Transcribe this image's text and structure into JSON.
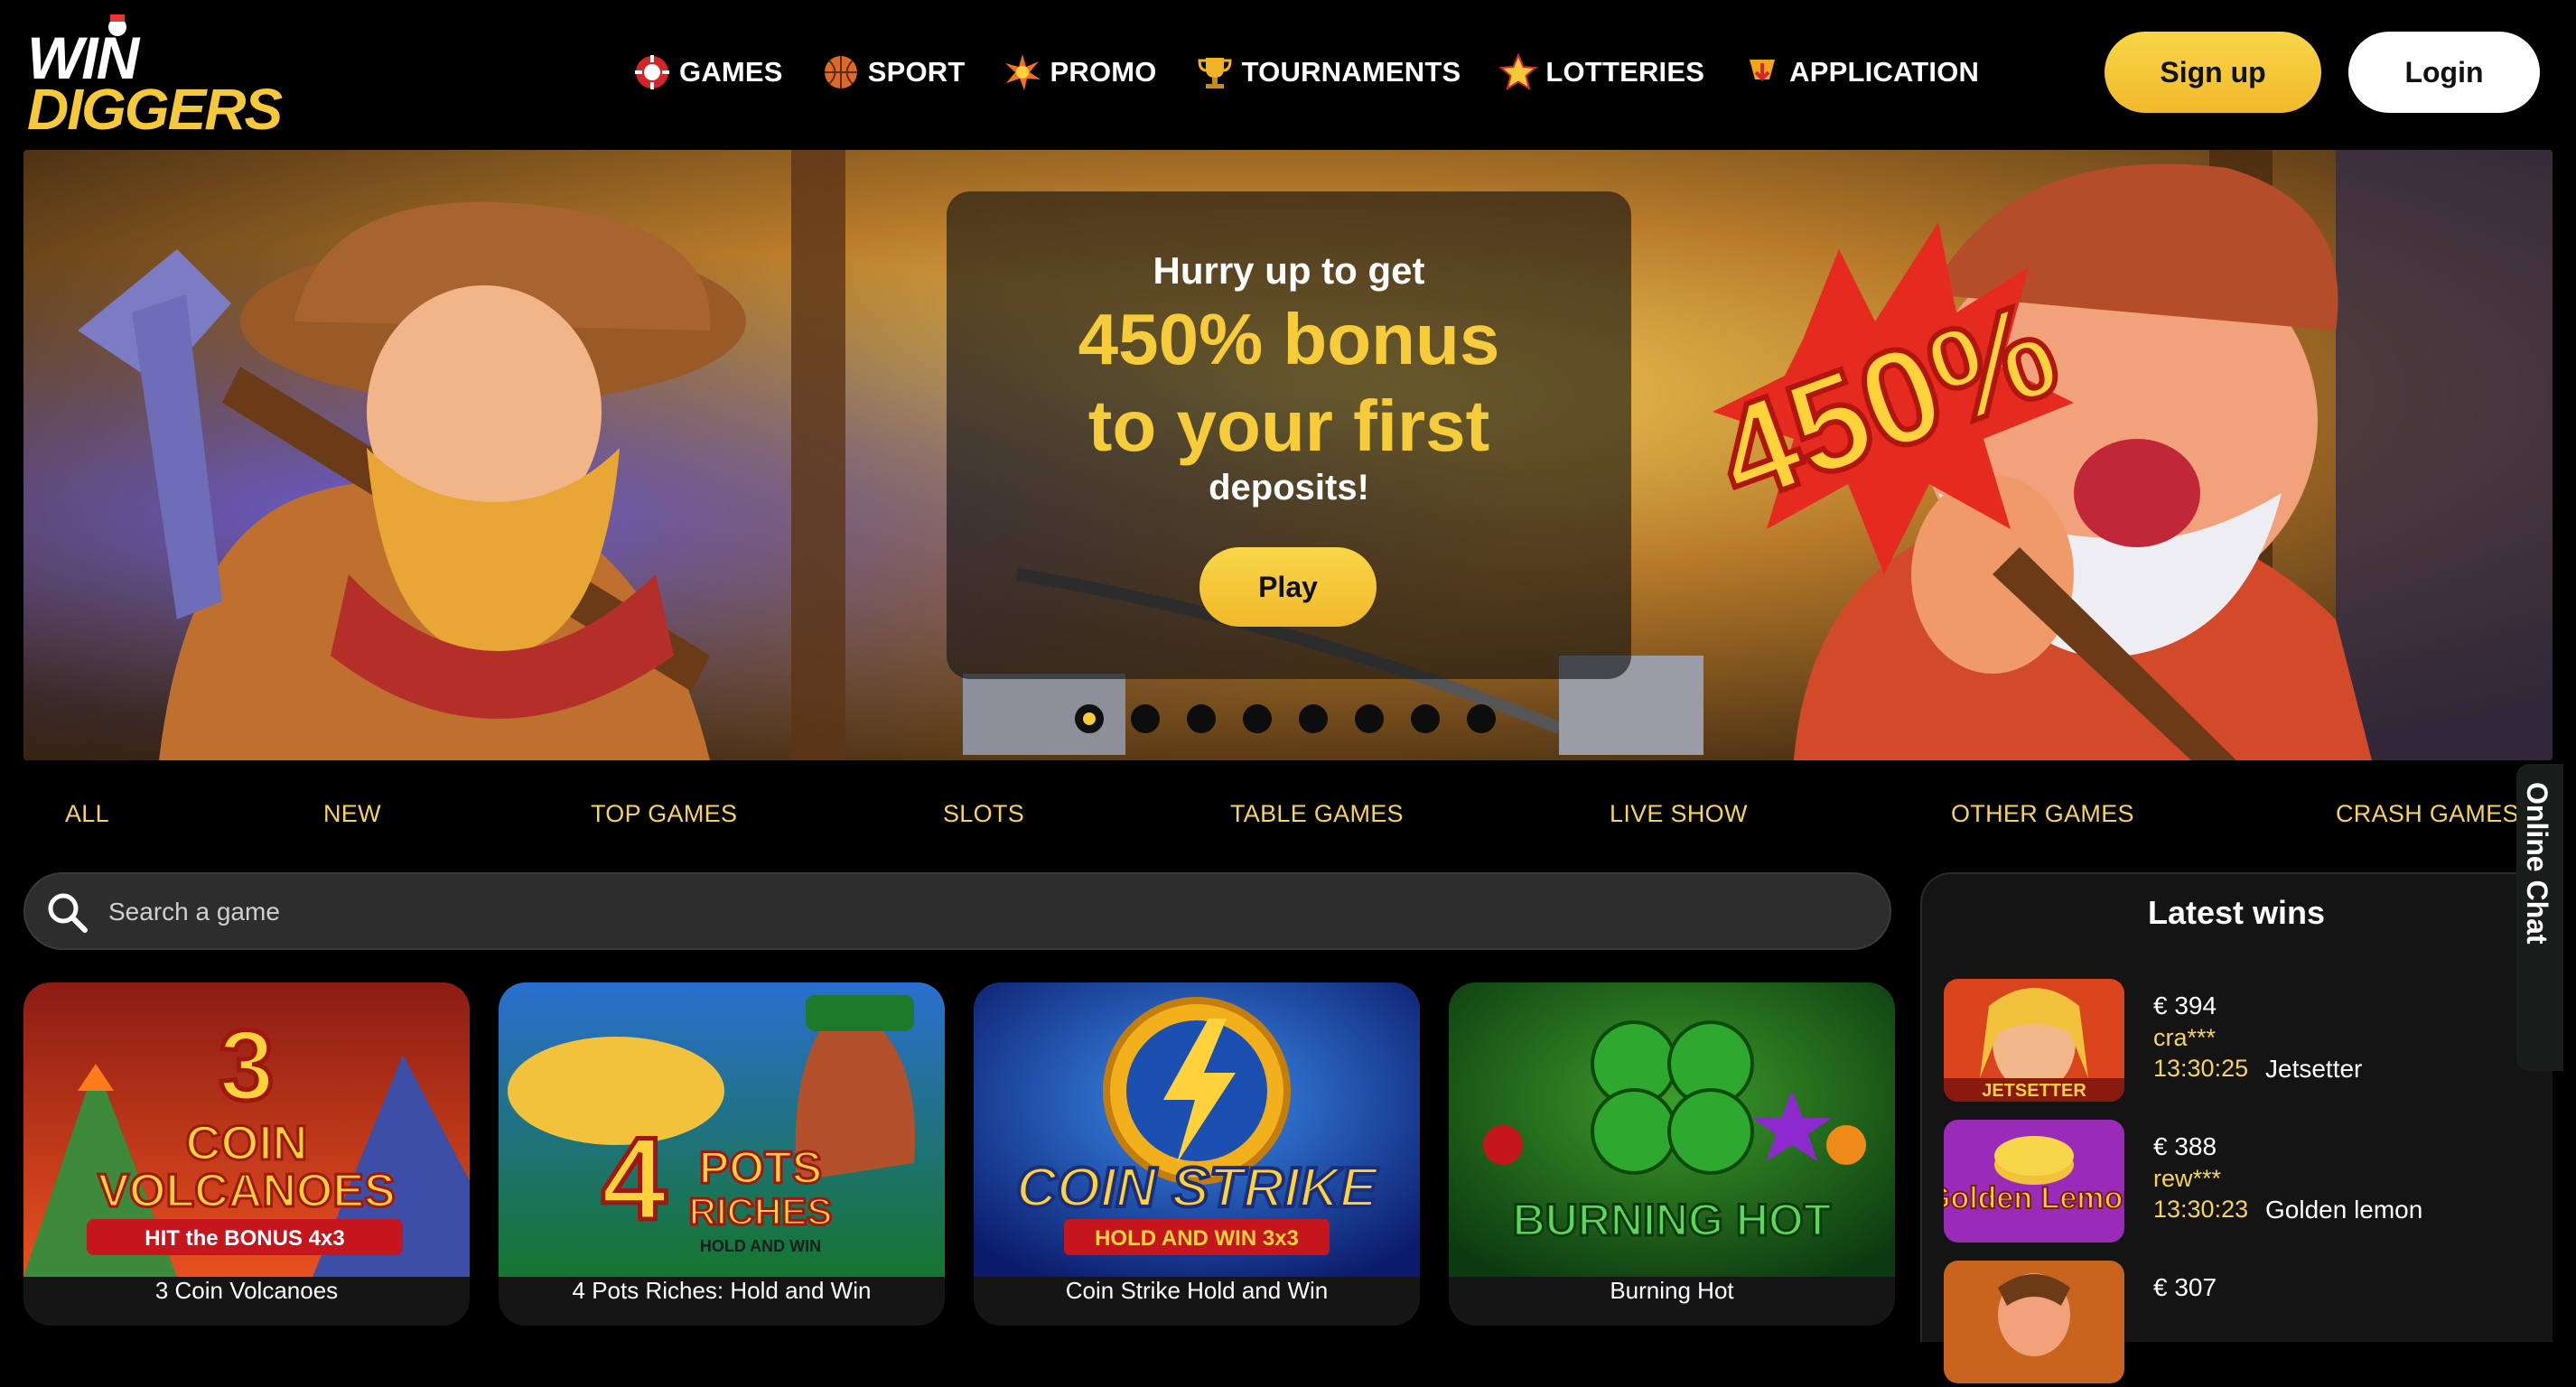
{
  "header": {
    "logo": {
      "line1": "WIN",
      "line2": "DIGGERS"
    },
    "nav": [
      {
        "label": "GAMES",
        "icon": "casino-chip-icon"
      },
      {
        "label": "SPORT",
        "icon": "basketball-icon"
      },
      {
        "label": "PROMO",
        "icon": "burst-icon"
      },
      {
        "label": "TOURNAMENTS",
        "icon": "trophy-icon"
      },
      {
        "label": "LOTTERIES",
        "icon": "star-icon"
      },
      {
        "label": "APPLICATION",
        "icon": "download-icon"
      }
    ],
    "signup_label": "Sign up",
    "login_label": "Login"
  },
  "banner": {
    "line1": "Hurry up to get",
    "line2": "450% bonus",
    "line3": "to your first",
    "line4": "deposits!",
    "badge": "450%",
    "play_label": "Play",
    "slide_count": 8,
    "active_slide": 1
  },
  "categories": [
    "ALL",
    "NEW",
    "TOP GAMES",
    "SLOTS",
    "TABLE GAMES",
    "LIVE SHOW",
    "OTHER GAMES",
    "CRASH GAMES"
  ],
  "search": {
    "placeholder": "Search a game"
  },
  "games": [
    {
      "name": "3 Coin Volcanoes",
      "art_title": "3",
      "art_sub1": "COIN",
      "art_sub2": "VOLCANOES",
      "art_tag": "HIT the BONUS 4x3"
    },
    {
      "name": "4 Pots Riches: Hold and Win",
      "art_title": "4",
      "art_sub1": "POTS",
      "art_sub2": "RICHES",
      "art_tag": "HOLD AND WIN"
    },
    {
      "name": "Coin Strike Hold and Win",
      "art_title": "COIN STRIKE",
      "art_tag": "HOLD AND WIN 3x3"
    },
    {
      "name": "Burning Hot",
      "art_title": "BURNING HOT"
    }
  ],
  "latest_wins": {
    "title": "Latest wins",
    "items": [
      {
        "amount": "€ 394",
        "user": "cra***",
        "time": "13:30:25",
        "game": "Jetsetter",
        "thumb_label": "JETSETTER"
      },
      {
        "amount": "€ 388",
        "user": "rew***",
        "time": "13:30:23",
        "game": "Golden lemon",
        "thumb_label": "Golden Lemon"
      },
      {
        "amount": "€ 307",
        "user": "",
        "time": "",
        "game": "",
        "thumb_label": ""
      }
    ]
  },
  "chat": {
    "label": "Online Chat"
  },
  "colors": {
    "accent": "#f6cc3a",
    "background": "#000000",
    "panel": "#141414",
    "search": "#2d2d2d"
  }
}
